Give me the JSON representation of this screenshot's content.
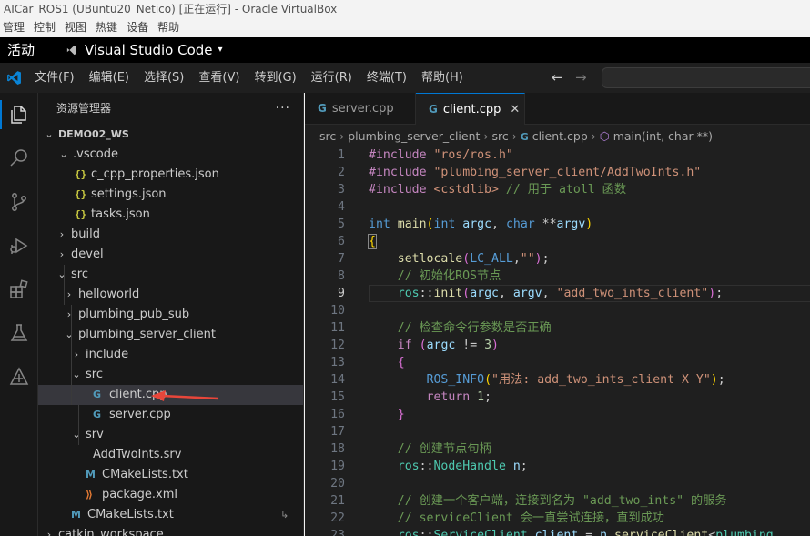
{
  "vbox": {
    "title": "AICar_ROS1 (UBuntu20_Netico) [正在运行] - Oracle VirtualBox",
    "menu": [
      "管理",
      "控制",
      "视图",
      "热键",
      "设备",
      "帮助"
    ]
  },
  "ubuntu_panel": {
    "activities": "活动",
    "app_name": "Visual Studio Code",
    "app_caret": "▾"
  },
  "menubar": {
    "items": [
      "文件(F)",
      "编辑(E)",
      "选择(S)",
      "查看(V)",
      "转到(G)",
      "运行(R)",
      "终端(T)",
      "帮助(H)"
    ],
    "back": "←",
    "forward": "→"
  },
  "sidebar": {
    "title": "资源管理器",
    "more": "···",
    "tree": [
      {
        "label": "DEMO02_WS",
        "chev": "⌄",
        "icon": "",
        "bold": true
      },
      {
        "label": ".vscode",
        "chev": "⌄",
        "icon": ""
      },
      {
        "label": "c_cpp_properties.json",
        "chev": "",
        "icon": "{}"
      },
      {
        "label": "settings.json",
        "chev": "",
        "icon": "{}"
      },
      {
        "label": "tasks.json",
        "chev": "",
        "icon": "{}"
      },
      {
        "label": "build",
        "chev": "›",
        "icon": ""
      },
      {
        "label": "devel",
        "chev": "›",
        "icon": ""
      },
      {
        "label": "src",
        "chev": "⌄",
        "icon": ""
      },
      {
        "label": "helloworld",
        "chev": "›",
        "icon": ""
      },
      {
        "label": "plumbing_pub_sub",
        "chev": "›",
        "icon": ""
      },
      {
        "label": "plumbing_server_client",
        "chev": "⌄",
        "icon": ""
      },
      {
        "label": "include",
        "chev": "›",
        "icon": ""
      },
      {
        "label": "src",
        "chev": "⌄",
        "icon": ""
      },
      {
        "label": "client.cpp",
        "chev": "",
        "icon": "G",
        "selected": true
      },
      {
        "label": "server.cpp",
        "chev": "",
        "icon": "G"
      },
      {
        "label": "srv",
        "chev": "⌄",
        "icon": ""
      },
      {
        "label": "AddTwoInts.srv",
        "chev": "",
        "icon": ""
      },
      {
        "label": "CMakeLists.txt",
        "chev": "",
        "icon": "M"
      },
      {
        "label": "package.xml",
        "chev": "",
        "icon": "⟫"
      },
      {
        "label": "CMakeLists.txt",
        "chev": "",
        "icon": "M",
        "badge": "↳"
      },
      {
        "label": "catkin_workspace",
        "chev": "›",
        "icon": ""
      }
    ]
  },
  "tabs": [
    {
      "label": "server.cpp",
      "icon": "G",
      "active": false
    },
    {
      "label": "client.cpp",
      "icon": "G",
      "active": true,
      "close": "✕"
    }
  ],
  "breadcrumb": {
    "parts": [
      "src",
      "plumbing_server_client",
      "src"
    ],
    "file": "client.cpp",
    "file_icon": "G",
    "symbol": "main(int, char **)",
    "symbol_icon": "⬡",
    "sep": "›"
  },
  "code": {
    "line_numbers": [
      "1",
      "2",
      "3",
      "4",
      "5",
      "6",
      "7",
      "8",
      "9",
      "10",
      "11",
      "12",
      "13",
      "14",
      "15",
      "16",
      "17",
      "18",
      "19",
      "20",
      "21",
      "22",
      "23"
    ],
    "active_line": 9
  },
  "colors": {
    "accent": "#0078d4",
    "arrow": "#e8463a"
  }
}
